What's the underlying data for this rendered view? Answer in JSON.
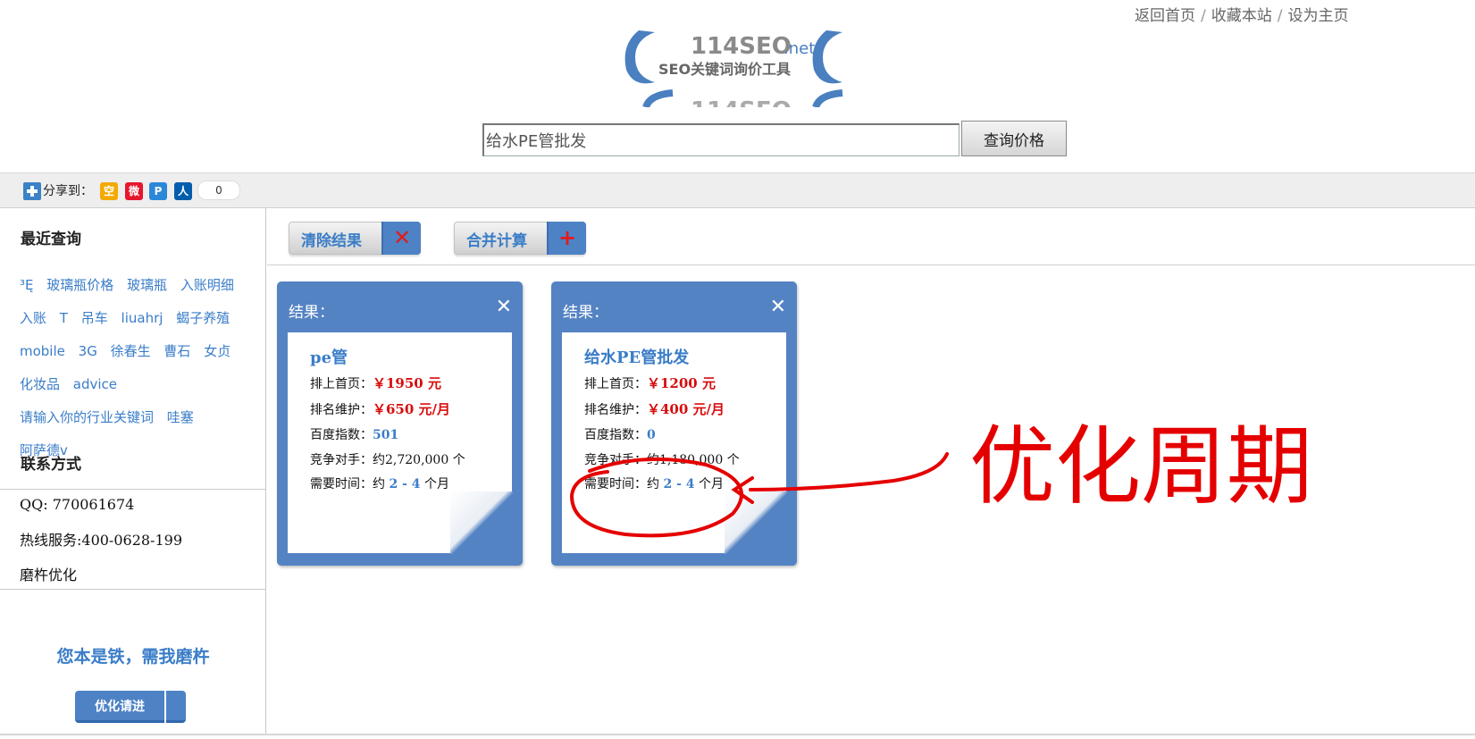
{
  "top_links": {
    "home": "返回首页",
    "favorite": "收藏本站",
    "set_homepage": "设为主页",
    "separator": "/"
  },
  "logo": {
    "text_main": "114SEO",
    "text_suffix": ".net",
    "tagline": "SEO关键词询价工具"
  },
  "search": {
    "value": "给水PE管批发",
    "button_label": "查询价格"
  },
  "share": {
    "label": "分享到：",
    "count": "0",
    "icons": [
      {
        "name": "qzone-icon",
        "glyph": "空",
        "color": "#f2a900"
      },
      {
        "name": "weibo-icon",
        "glyph": "微",
        "color": "#e6162d"
      },
      {
        "name": "pengyou-icon",
        "glyph": "P",
        "color": "#2b88d8"
      },
      {
        "name": "renren-icon",
        "glyph": "人",
        "color": "#005eac"
      }
    ]
  },
  "sidebar": {
    "recent_title": "最近查询",
    "recent_items": [
      "³Ę",
      "玻璃瓶价格",
      "玻璃瓶",
      "入账明细",
      "入账",
      "T",
      "吊车",
      "liuahrj",
      "蝎子养殖",
      "mobile",
      "3G",
      "徐春生",
      "曹石",
      "女贞",
      "化妆品",
      "advice",
      "请输入你的行业关键词",
      "哇塞",
      "阿萨德v"
    ],
    "contact_title": "联系方式",
    "qq": "QQ: 770061674",
    "hotline": "热线服务:400-0628-199",
    "company": "磨杵优化",
    "slogan": "您本是铁，需我磨杵",
    "tab_label": "优化请进"
  },
  "actions": {
    "clear_label": "清除结果",
    "merge_label": "合并计算",
    "clear_icon": "✕",
    "merge_icon": "+"
  },
  "results": [
    {
      "title": "结果：",
      "keyword": "pe管",
      "home_label": "排上首页：",
      "home_price": "￥1950 元",
      "maint_label": "排名维护：",
      "maint_price": "￥650 元/月",
      "index_label": "百度指数：",
      "index_value": "501",
      "competitors_label": "竞争对手：",
      "competitors_value": "约2,720,000 个",
      "time_label": "需要时间：约",
      "time_value": "2 - 4",
      "time_unit": "个月"
    },
    {
      "title": "结果：",
      "keyword": "给水PE管批发",
      "home_label": "排上首页：",
      "home_price": "￥1200 元",
      "maint_label": "排名维护：",
      "maint_price": "￥400 元/月",
      "index_label": "百度指数：",
      "index_value": "0",
      "competitors_label": "竞争对手：",
      "competitors_value": "约1,180,000 个",
      "time_label": "需要时间：约",
      "time_value": "2 - 4",
      "time_unit": "个月"
    }
  ],
  "annotation": {
    "text": "优化周期",
    "color": "#e50000"
  }
}
